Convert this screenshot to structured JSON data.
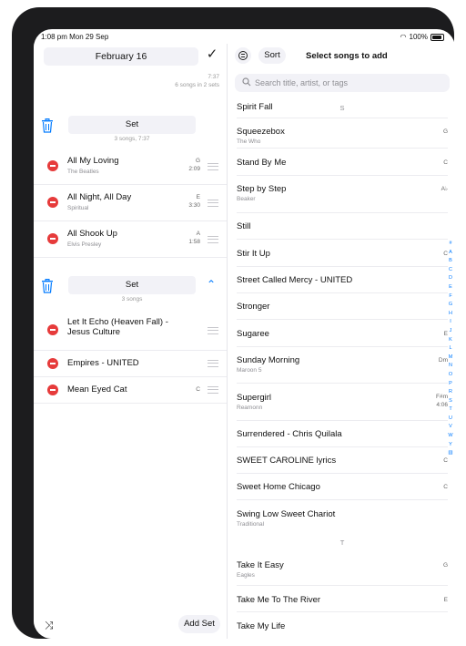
{
  "status": {
    "time": "1:08 pm  Mon 29 Sep",
    "battery": "100%"
  },
  "left": {
    "date": "February 16",
    "summary_time": "7:37",
    "summary_counts": "6 songs in 2 sets",
    "sets": [
      {
        "label": "Set",
        "subtitle": "3 songs, 7:37",
        "songs": [
          {
            "title": "All My Loving",
            "artist": "The Beatles",
            "key": "G",
            "duration": "2:09"
          },
          {
            "title": "All Night, All Day",
            "artist": "Spiritual",
            "key": "E",
            "duration": "3:30"
          },
          {
            "title": "All Shook Up",
            "artist": "Elvis Presley",
            "key": "A",
            "duration": "1:58"
          }
        ]
      },
      {
        "label": "Set",
        "subtitle": "3 songs",
        "songs": [
          {
            "title": "Let It Echo (Heaven Fall) - Jesus Culture",
            "artist": "",
            "key": "",
            "duration": ""
          },
          {
            "title": "Empires - UNITED",
            "artist": "",
            "key": "",
            "duration": ""
          },
          {
            "title": "Mean Eyed Cat",
            "artist": "",
            "key": "C",
            "duration": ""
          }
        ]
      }
    ],
    "add_set_label": "Add Set"
  },
  "right": {
    "sort_label": "Sort",
    "title": "Select songs to add",
    "search_placeholder": "Search title, artist, or tags",
    "section_s": "S",
    "section_t": "T",
    "songs": [
      {
        "title": "Spirit Fall",
        "artist": "",
        "key": ""
      },
      {
        "title": "Squeezebox",
        "artist": "The Who",
        "key": "G"
      },
      {
        "title": "Stand By Me",
        "artist": "",
        "key": "C"
      },
      {
        "title": "Step by Step",
        "artist": "Beaker",
        "key": "A♭"
      },
      {
        "title": "Still",
        "artist": "",
        "key": ""
      },
      {
        "title": "Stir It Up",
        "artist": "",
        "key": "C"
      },
      {
        "title": "Street Called Mercy - UNITED",
        "artist": "",
        "key": ""
      },
      {
        "title": "Stronger",
        "artist": "",
        "key": ""
      },
      {
        "title": "Sugaree",
        "artist": "",
        "key": "E"
      },
      {
        "title": "Sunday Morning",
        "artist": "Maroon 5",
        "key": "Dm"
      },
      {
        "title": "Supergirl",
        "artist": "Reamonn",
        "key": "F#m",
        "duration": "4:06"
      },
      {
        "title": "Surrendered - Chris Quilala",
        "artist": "",
        "key": ""
      },
      {
        "title": "SWEET CAROLINE lyrics",
        "artist": "",
        "key": "C"
      },
      {
        "title": "Sweet Home Chicago",
        "artist": "",
        "key": "C"
      },
      {
        "title": "Swing Low Sweet Chariot",
        "artist": "Traditional",
        "key": ""
      },
      {
        "title": "Take It Easy",
        "artist": "Eagles",
        "key": "G"
      },
      {
        "title": "Take Me To The River",
        "artist": "",
        "key": "E"
      },
      {
        "title": "Take My Life",
        "artist": "",
        "key": ""
      }
    ],
    "index_letters": [
      "#",
      "A",
      "B",
      "C",
      "D",
      "E",
      "F",
      "G",
      "H",
      "I",
      "J",
      "K",
      "L",
      "M",
      "N",
      "O",
      "P",
      "R",
      "S",
      "T",
      "U",
      "V",
      "W",
      "Y",
      "▥"
    ]
  },
  "colors": {
    "accent": "#007aff",
    "delete": "#e63b3b",
    "pill": "#f2f2f7"
  }
}
